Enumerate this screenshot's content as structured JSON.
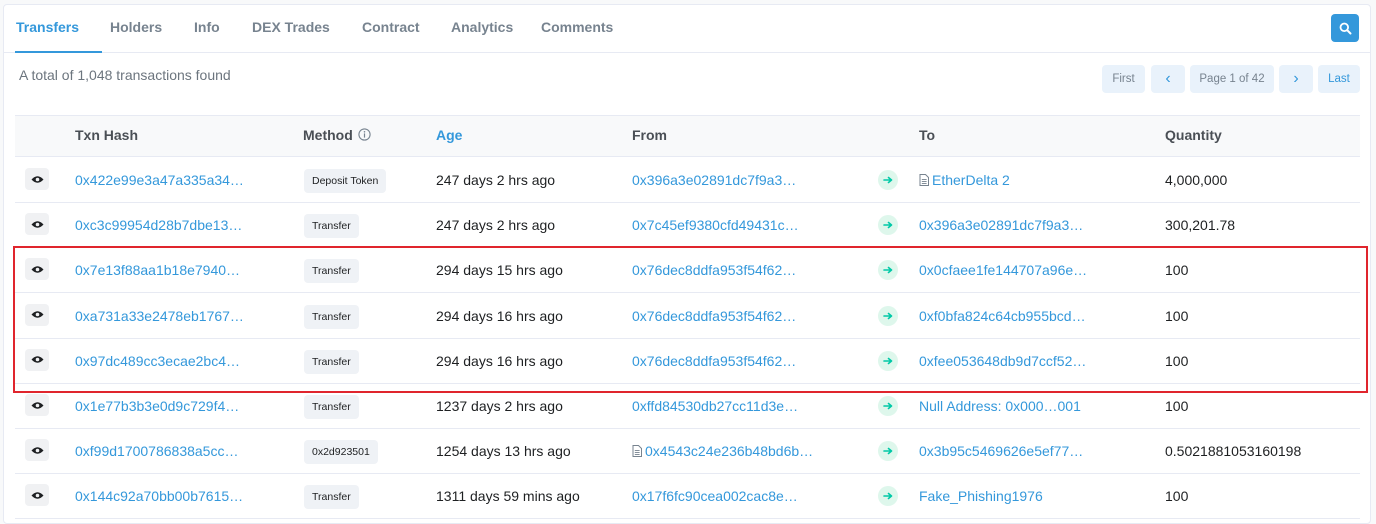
{
  "tabs": [
    {
      "label": "Transfers",
      "active": true
    },
    {
      "label": "Holders",
      "active": false
    },
    {
      "label": "Info",
      "active": false
    },
    {
      "label": "DEX Trades",
      "active": false
    },
    {
      "label": "Contract",
      "active": false
    },
    {
      "label": "Analytics",
      "active": false
    },
    {
      "label": "Comments",
      "active": false
    }
  ],
  "search_icon": "search-icon",
  "summary": "A total of 1,048 transactions found",
  "pagination": {
    "first": "First",
    "prev": "‹",
    "page": "Page 1 of 42",
    "next": "›",
    "last": "Last"
  },
  "columns": {
    "txn_hash": "Txn Hash",
    "method": "Method",
    "age": "Age",
    "from": "From",
    "to": "To",
    "quantity": "Quantity"
  },
  "rows": [
    {
      "hash": "0x422e99e3a47a335a34…",
      "method": "Deposit Token",
      "age": "247 days 2 hrs ago",
      "from": "0x396a3e02891dc7f9a3…",
      "from_contract": false,
      "to": "EtherDelta 2",
      "to_contract": true,
      "quantity": "4,000,000"
    },
    {
      "hash": "0xc3c99954d28b7dbe13…",
      "method": "Transfer",
      "age": "247 days 2 hrs ago",
      "from": "0x7c45ef9380cfd49431c…",
      "from_contract": false,
      "to": "0x396a3e02891dc7f9a3…",
      "to_contract": false,
      "quantity": "300,201.78"
    },
    {
      "hash": "0x7e13f88aa1b18e7940…",
      "method": "Transfer",
      "age": "294 days 15 hrs ago",
      "from": "0x76dec8ddfa953f54f62…",
      "from_contract": false,
      "to": "0x0cfaee1fe144707a96e…",
      "to_contract": false,
      "quantity": "100"
    },
    {
      "hash": "0xa731a33e2478eb1767…",
      "method": "Transfer",
      "age": "294 days 16 hrs ago",
      "from": "0x76dec8ddfa953f54f62…",
      "from_contract": false,
      "to": "0xf0bfa824c64cb955bcd…",
      "to_contract": false,
      "quantity": "100"
    },
    {
      "hash": "0x97dc489cc3ecae2bc4…",
      "method": "Transfer",
      "age": "294 days 16 hrs ago",
      "from": "0x76dec8ddfa953f54f62…",
      "from_contract": false,
      "to": "0xfee053648db9d7ccf52…",
      "to_contract": false,
      "quantity": "100"
    },
    {
      "hash": "0x1e77b3b3e0d9c729f4…",
      "method": "Transfer",
      "age": "1237 days 2 hrs ago",
      "from": "0xffd84530db27cc11d3e…",
      "from_contract": false,
      "to": "Null Address: 0x000…001",
      "to_contract": false,
      "quantity": "100"
    },
    {
      "hash": "0xf99d1700786838a5cc…",
      "method": "0x2d923501",
      "age": "1254 days 13 hrs ago",
      "from": "0x4543c24e236b48bd6b…",
      "from_contract": true,
      "to": "0x3b95c5469626e5ef77…",
      "to_contract": false,
      "quantity": "0.5021881053160198"
    },
    {
      "hash": "0x144c92a70bb00b7615…",
      "method": "Transfer",
      "age": "1311 days 59 mins ago",
      "from": "0x17f6fc90cea002cac8e…",
      "from_contract": false,
      "to": "Fake_Phishing1976",
      "to_contract": false,
      "quantity": "100"
    }
  ],
  "colors": {
    "accent": "#3498db",
    "highlight_border": "#e0252d",
    "arrow_bg": "#def7ec",
    "arrow_fg": "#00c9a7"
  }
}
